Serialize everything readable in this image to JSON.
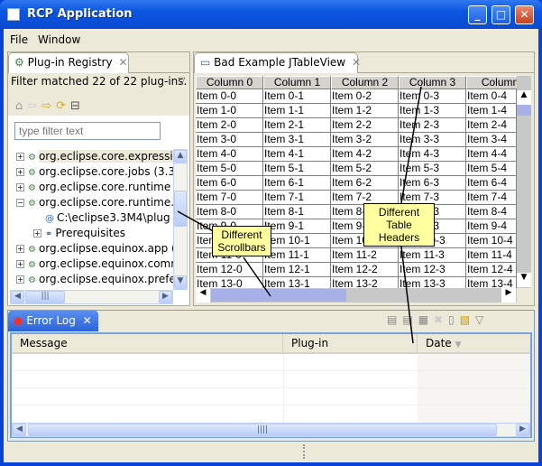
{
  "window": {
    "title": "RCP Application",
    "minimize": "_",
    "maximize": "□",
    "close": "✕"
  },
  "menu": [
    "File",
    "Window"
  ],
  "registry": {
    "tab_label": "Plug-in Registry",
    "filter_status": "Filter matched 22 of 22 plug-ins.",
    "filter_placeholder": "type filter text",
    "tree": [
      {
        "label": "org.eclipse.core.expressi",
        "expander": "+",
        "kind": "plugin",
        "level": 0,
        "selected": true
      },
      {
        "label": "org.eclipse.core.jobs (3.3",
        "expander": "+",
        "kind": "plugin",
        "level": 0
      },
      {
        "label": "org.eclipse.core.runtime (",
        "expander": "+",
        "kind": "plugin",
        "level": 0
      },
      {
        "label": "org.eclipse.core.runtime.",
        "expander": "−",
        "kind": "plugin",
        "level": 0
      },
      {
        "label": "C:\\eclipse3.3M4\\plug",
        "expander": "",
        "kind": "location",
        "level": 1
      },
      {
        "label": "Prerequisites",
        "expander": "+",
        "kind": "prereq",
        "level": 1
      },
      {
        "label": "org.eclipse.equinox.app (",
        "expander": "+",
        "kind": "plugin",
        "level": 0
      },
      {
        "label": "org.eclipse.equinox.comm",
        "expander": "+",
        "kind": "plugin",
        "level": 0
      },
      {
        "label": "org.eclipse.equinox.prefe",
        "expander": "+",
        "kind": "plugin",
        "level": 0
      }
    ]
  },
  "jtable": {
    "tab_label": "Bad Example JTableView",
    "columns": [
      "Column 0",
      "Column 1",
      "Column 2",
      "Column 3",
      "Column"
    ],
    "rows": [
      [
        "Item 0-0",
        "Item 0-1",
        "Item 0-2",
        "Item 0-3",
        "Item 0-4"
      ],
      [
        "Item 1-0",
        "Item 1-1",
        "Item 1-2",
        "Item 1-3",
        "Item 1-4"
      ],
      [
        "Item 2-0",
        "Item 2-1",
        "Item 2-2",
        "Item 2-3",
        "Item 2-4"
      ],
      [
        "Item 3-0",
        "Item 3-1",
        "Item 3-2",
        "Item 3-3",
        "Item 3-4"
      ],
      [
        "Item 4-0",
        "Item 4-1",
        "Item 4-2",
        "Item 4-3",
        "Item 4-4"
      ],
      [
        "Item 5-0",
        "Item 5-1",
        "Item 5-2",
        "Item 5-3",
        "Item 5-4"
      ],
      [
        "Item 6-0",
        "Item 6-1",
        "Item 6-2",
        "Item 6-3",
        "Item 6-4"
      ],
      [
        "Item 7-0",
        "Item 7-1",
        "Item 7-2",
        "Item 7-3",
        "Item 7-4"
      ],
      [
        "Item 8-0",
        "Item 8-1",
        "Item 8-2",
        "Item 8-3",
        "Item 8-4"
      ],
      [
        "Item 9-0",
        "Item 9-1",
        "Item 9-2",
        "Item 9-3",
        "Item 9-4"
      ],
      [
        "Item 10-0",
        "Item 10-1",
        "Item 10-2",
        "Item 10-3",
        "Item 10-4"
      ],
      [
        "Item 11-0",
        "Item 11-1",
        "Item 11-2",
        "Item 11-3",
        "Item 11-4"
      ],
      [
        "Item 12-0",
        "Item 12-1",
        "Item 12-2",
        "Item 12-3",
        "Item 12-4"
      ],
      [
        "Item 13-0",
        "Item 13-1",
        "Item 13-2",
        "Item 13-3",
        "Item 13-4"
      ]
    ]
  },
  "errorlog": {
    "tab_label": "Error Log",
    "columns": [
      "Message",
      "Plug-in",
      "Date"
    ]
  },
  "callouts": {
    "scrollbars": [
      "Different",
      "Scrollbars"
    ],
    "headers": [
      "Different",
      "Table Headers"
    ]
  }
}
